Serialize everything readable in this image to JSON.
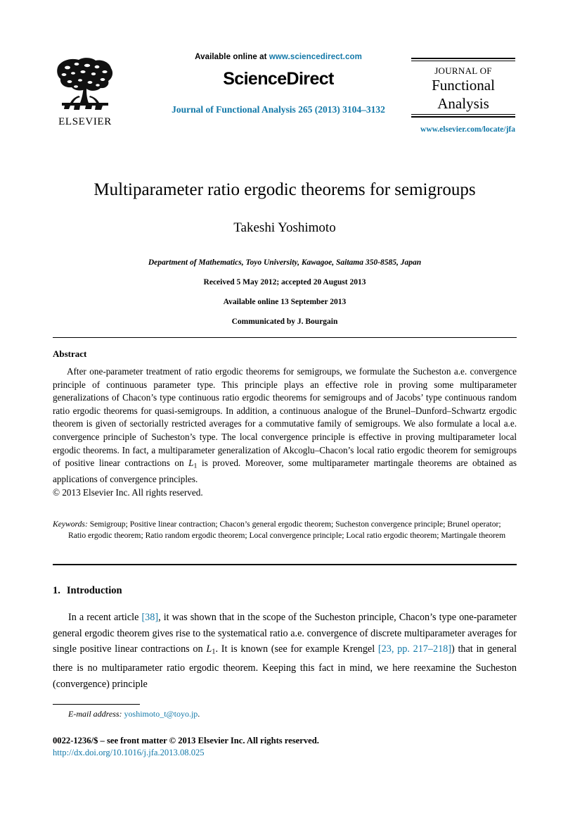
{
  "header": {
    "publisher_logo_name": "ELSEVIER",
    "available_online_prefix": "Available online at ",
    "sciencedirect_url": "www.sciencedirect.com",
    "sciencedirect_wordmark": "ScienceDirect",
    "journal_citation": "Journal of Functional Analysis 265 (2013) 3104–3132",
    "journal_of": "Journal of",
    "journal_name_line1": "Functional",
    "journal_name_line2": "Analysis",
    "journal_url": "www.elsevier.com/locate/jfa"
  },
  "article": {
    "title": "Multiparameter ratio ergodic theorems for semigroups",
    "author": "Takeshi Yoshimoto",
    "affiliation": "Department of Mathematics, Toyo University, Kawagoe, Saitama 350-8585, Japan",
    "received": "Received 5 May 2012; accepted 20 August 2013",
    "available_online": "Available online 13 September 2013",
    "communicated_by": "Communicated by J. Bourgain"
  },
  "abstract": {
    "heading": "Abstract",
    "part1": "After one-parameter treatment of ratio ergodic theorems for semigroups, we formulate the Sucheston a.e. convergence principle of continuous parameter type. This principle plays an effective role in proving some multiparameter generalizations of Chacon’s type continuous ratio ergodic theorems for semigroups and of Jacobs’ type continuous random ratio ergodic theorems for quasi-semigroups. In addition, a continuous analogue of the Brunel–Dunford–Schwartz ergodic theorem is given of sectorially restricted averages for a commutative family of semigroups. We also formulate a local a.e. convergence principle of Sucheston’s type. The local convergence principle is effective in proving multiparameter local ergodic theorems. In fact, a multiparameter generalization of Akcoglu–Chacon’s local ratio ergodic theorem for semigroups of positive linear contractions on ",
    "math_L": "L",
    "math_L_sub": "1",
    "part2": " is proved. Moreover, some multiparameter martingale theorems are obtained as applications of convergence principles.",
    "copyright": "© 2013 Elsevier Inc. All rights reserved."
  },
  "keywords": {
    "label": "Keywords:",
    "text": " Semigroup; Positive linear contraction; Chacon’s general ergodic theorem; Sucheston convergence principle; Brunel operator; Ratio ergodic theorem; Ratio random ergodic theorem; Local convergence principle; Local ratio ergodic theorem; Martingale theorem"
  },
  "introduction": {
    "number": "1.",
    "heading": "Introduction",
    "p1_a": "In a recent article ",
    "p1_ref1": "[38]",
    "p1_b": ", it was shown that in the scope of the Sucheston principle, Chacon’s type one-parameter general ergodic theorem gives rise to the systematical ratio a.e. convergence of discrete multiparameter averages for single positive linear contractions on ",
    "p1_math_L": "L",
    "p1_math_L_sub": "1",
    "p1_c": ". It is known (see for example Krengel ",
    "p1_ref2": "[23, pp. 217–218]",
    "p1_d": ") that in general there is no multiparameter ratio ergodic theorem. Keeping this fact in mind, we here reexamine the Sucheston (convergence) principle"
  },
  "footer": {
    "email_label": "E-mail address:",
    "email_value": " yoshimoto_t@toyo.jp",
    "email_period": ".",
    "issn_line": "0022-1236/$ – see front matter © 2013 Elsevier Inc. All rights reserved.",
    "doi_url": "http://dx.doi.org/10.1016/j.jfa.2013.08.025"
  },
  "colors": {
    "link_blue": "#1278a8",
    "text_black": "#000000",
    "page_background": "#ffffff"
  }
}
